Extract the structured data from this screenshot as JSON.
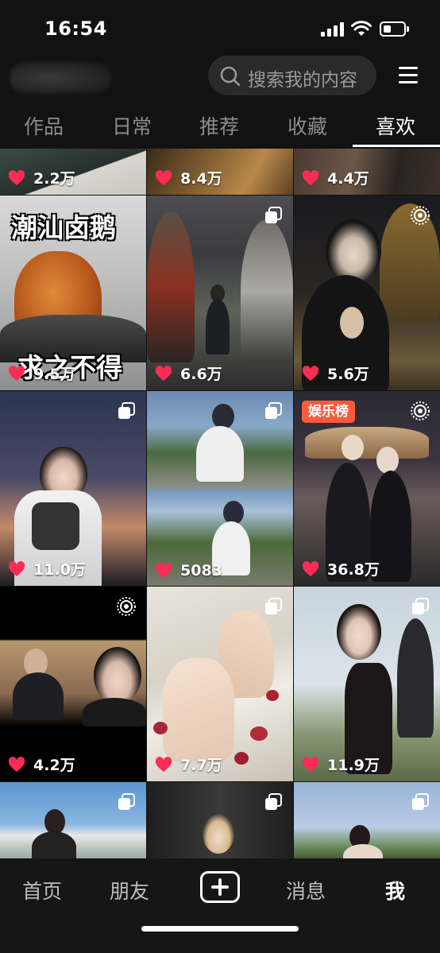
{
  "status_bar": {
    "time": "16:54"
  },
  "header": {
    "search_placeholder": "搜索我的内容"
  },
  "tabs": [
    {
      "label": "作品"
    },
    {
      "label": "日常"
    },
    {
      "label": "推荐"
    },
    {
      "label": "收藏"
    },
    {
      "label": "喜欢",
      "active": true
    }
  ],
  "grid": {
    "row0": [
      "2.2万",
      "8.4万",
      "4.4万"
    ],
    "row1": [
      {
        "likes": "9.5万",
        "title_top": "潮汕卤鹅",
        "title_bottom": "求之不得"
      },
      {
        "likes": "6.6万",
        "icon": "multi-photo-icon"
      },
      {
        "likes": "5.6万",
        "icon": "live-icon"
      }
    ],
    "row2": [
      {
        "likes": "11.0万",
        "icon": "multi-photo-icon"
      },
      {
        "likes": "5083",
        "icon": "multi-photo-icon"
      },
      {
        "likes": "36.8万",
        "icon": "live-icon",
        "badge": "娱乐榜"
      }
    ],
    "row3": [
      {
        "likes": "4.2万",
        "icon": "live-icon"
      },
      {
        "likes": "7.7万",
        "icon": "multi-photo-icon"
      },
      {
        "likes": "11.9万",
        "icon": "multi-photo-icon"
      }
    ]
  },
  "bottom_nav": {
    "home": "首页",
    "friends": "朋友",
    "messages": "消息",
    "me": "我"
  },
  "colors": {
    "heart": "#fe2c55",
    "background": "#121212",
    "badge": "#ff5a3c"
  }
}
